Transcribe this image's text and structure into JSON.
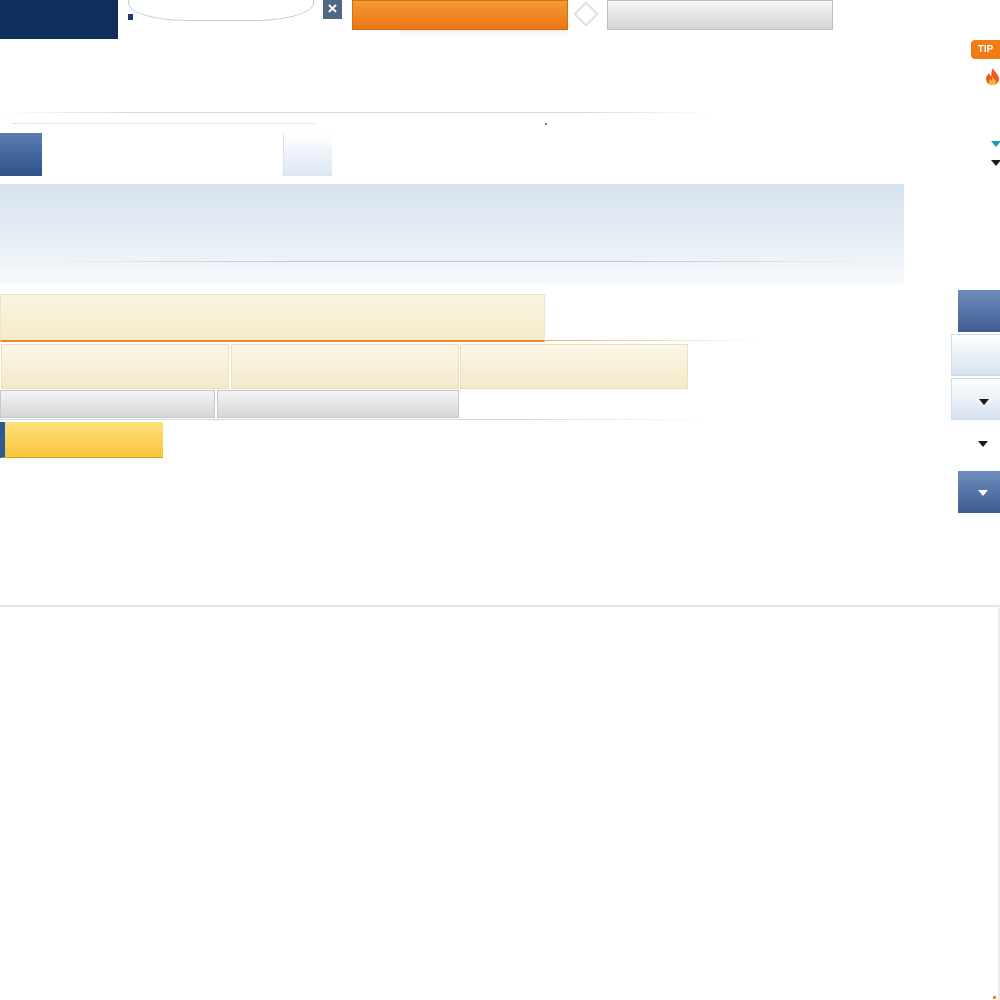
{
  "header": {
    "tip_badge": "TIP"
  },
  "icons": {
    "close": "close-icon",
    "fire": "fire-icon",
    "dropdown": "caret-down-icon"
  },
  "colors": {
    "navy": "#0e2f5b",
    "orange": "#ec7512",
    "teal": "#159bb6",
    "gold": "#f8c43c"
  }
}
